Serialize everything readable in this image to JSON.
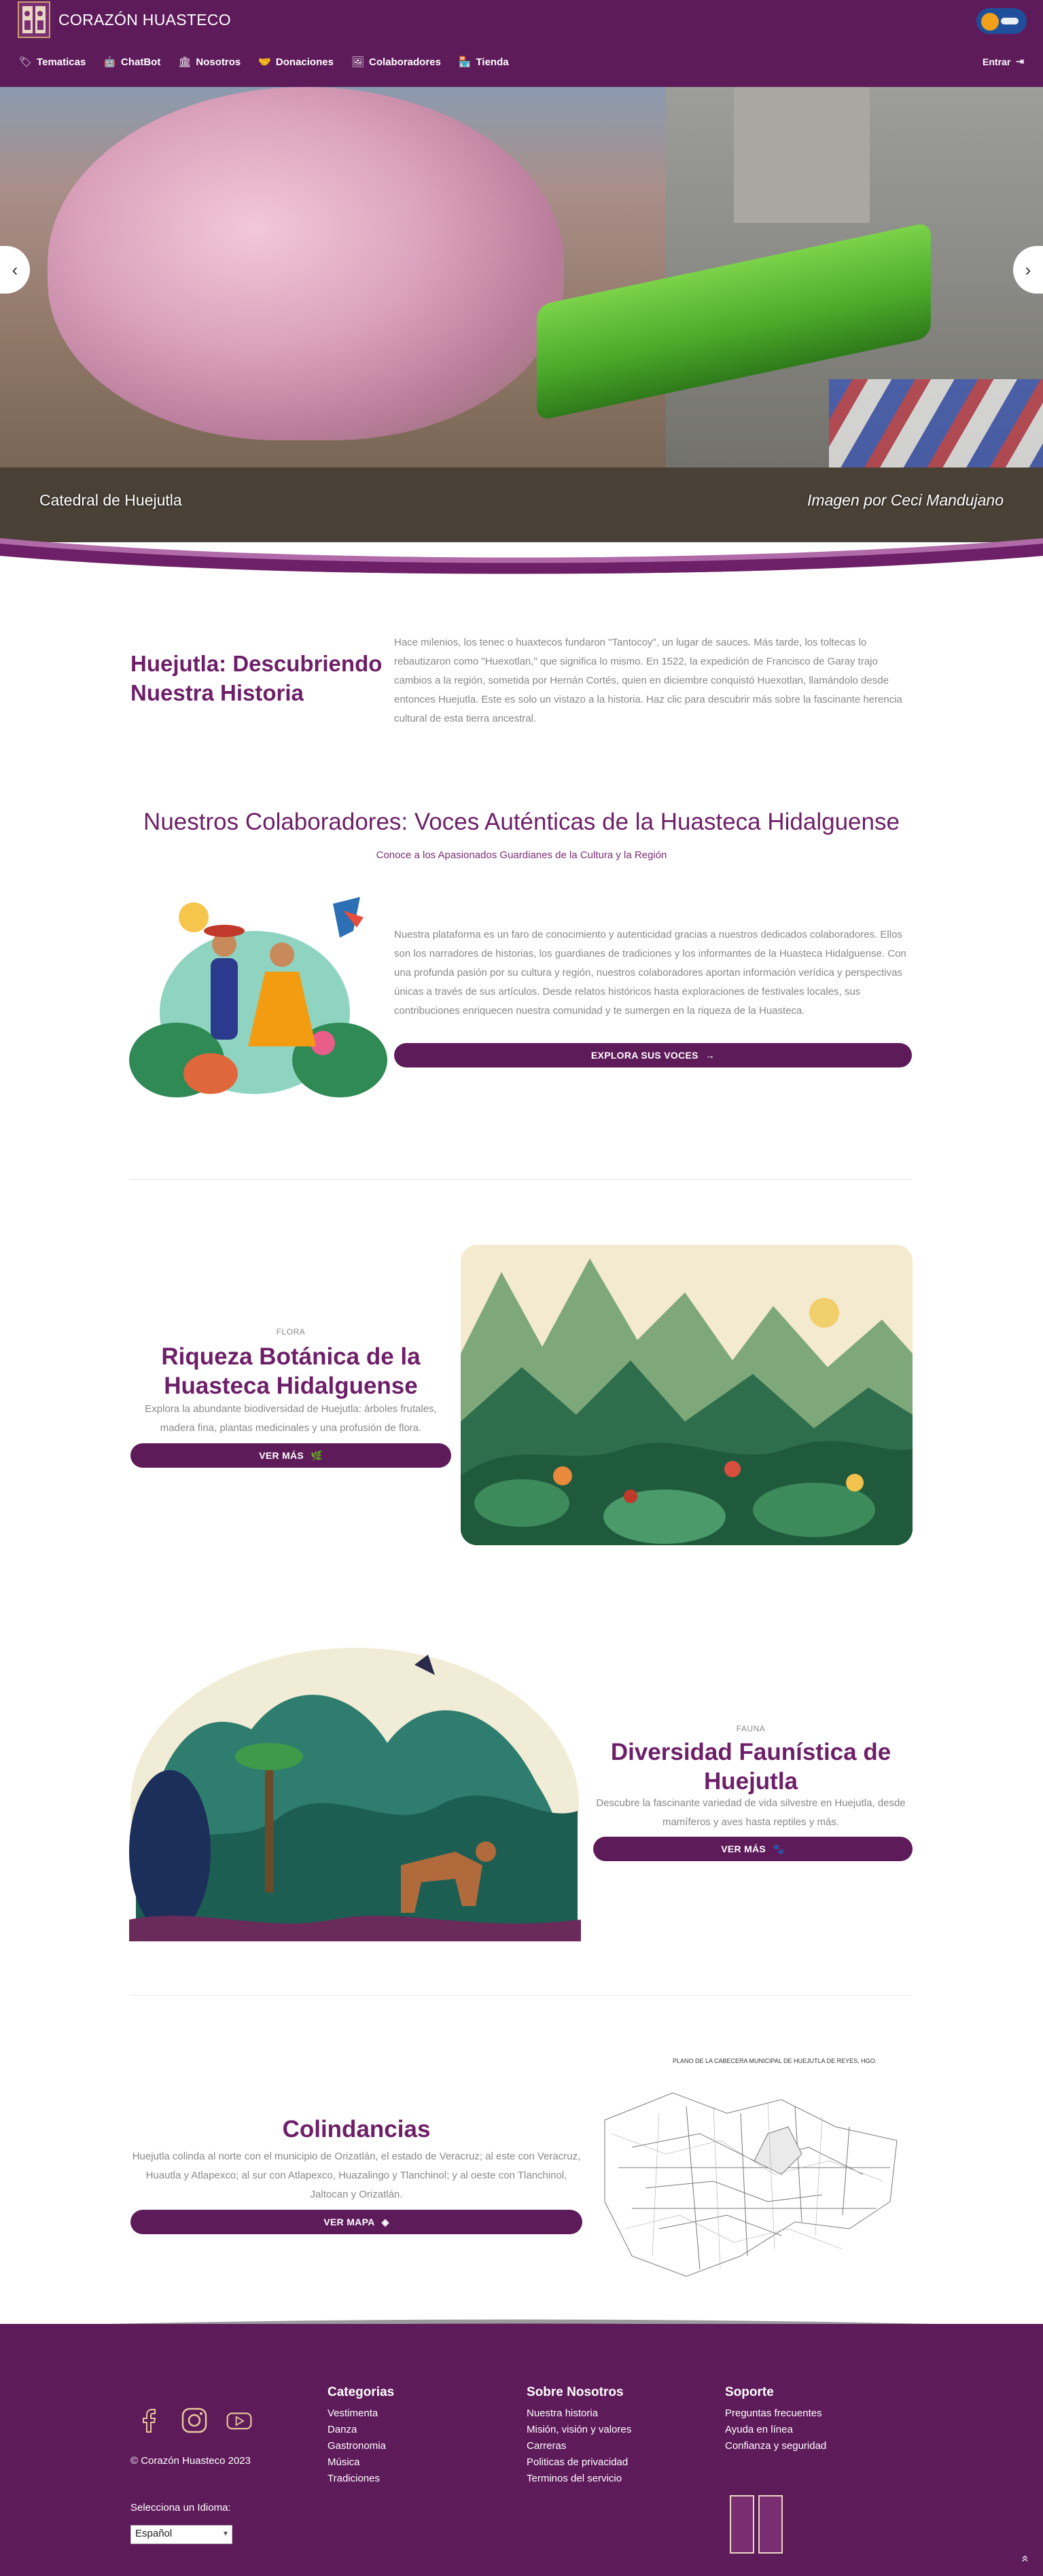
{
  "brand": {
    "name": "CORAZÓN HUASTECO"
  },
  "nav": {
    "items": [
      {
        "label": "Tematicas",
        "icon": "🏷"
      },
      {
        "label": "ChatBot",
        "icon": "🤖"
      },
      {
        "label": "Nosotros",
        "icon": "🏛"
      },
      {
        "label": "Donaciones",
        "icon": "🤝"
      },
      {
        "label": "Colaboradores",
        "icon": "🖼"
      },
      {
        "label": "Tienda",
        "icon": "🏪"
      }
    ],
    "login_label": "Entrar",
    "login_icon": "⇥"
  },
  "hero": {
    "caption": "Catedral de Huejutla",
    "credit": "Imagen por Ceci Mandujano"
  },
  "history": {
    "title": "Huejutla: Descubriendo Nuestra Historia",
    "text": "Hace milenios, los tenec o huaxtecos fundaron \"Tantocoy\", un lugar de sauces. Más tarde, los toltecas lo rebautizaron como \"Huexotlan,\" que significa lo mismo. En 1522, la expedición de Francisco de Garay trajo cambios a la región, sometida por Hernán Cortés, quien en diciembre conquistó Huexotlan, llamándolo desde entonces Huejutla. Este es solo un vistazo a la historia. Haz clic para descubrir más sobre la fascinante herencia cultural de esta tierra ancestral."
  },
  "collaborators": {
    "title": "Nuestros Colaboradores: Voces Auténticas de la Huasteca Hidalguense",
    "subtitle": "Conoce a los Apasionados Guardianes de la Cultura y la Región",
    "text": "Nuestra plataforma es un faro de conocimiento y autenticidad gracias a nuestros dedicados colaboradores. Ellos son los narradores de historias, los guardianes de tradiciones y los informantes de la Huasteca Hidalguense. Con una profunda pasión por su cultura y región, nuestros colaboradores aportan información verídica y perspectivas únicas a través de sus artículos. Desde relatos históricos hasta exploraciones de festivales locales, sus contribuciones enriquecen nuestra comunidad y te sumergen en la riqueza de la Huasteca.",
    "button": "EXPLORA SUS VOCES",
    "button_icon": "→"
  },
  "flora": {
    "label": "FLORA",
    "title": "Riqueza Botánica de la Huasteca Hidalguense",
    "text": "Explora la abundante biodiversidad de Huejutla: árboles frutales, madera fina, plantas medicinales y una profusión de flora.",
    "button": "VER MÁS",
    "button_icon": "🌿"
  },
  "fauna": {
    "label": "FAUNA",
    "title": "Diversidad Faunística de Huejutla",
    "text": "Descubre la fascinante variedad de vida silvestre en Huejutla, desde mamíferos y aves hasta reptiles y más.",
    "button": "VER MÁS",
    "button_icon": "🐾"
  },
  "borders": {
    "title": "Colindancias",
    "text": "Huejutla colinda al norte con el municipio de Orizatlán, el estado de Veracruz; al este con Veracruz, Huautla y Atlapexco; al sur con Atlapexco, Huazalingo y Tlanchinol; y al oeste con Tlanchinol, Jaltocan y Orizatlán.",
    "button": "VER MAPA",
    "button_icon": "◈",
    "map_heading": "PLANO DE LA CABECERA MUNICIPAL DE HUEJUTLA DE REYES, HGO."
  },
  "footer": {
    "copyright": "© Corazón Huasteco 2023",
    "columns": [
      {
        "title": "Categorias",
        "items": [
          "Vestimenta",
          "Danza",
          "Gastronomia",
          "Música",
          "Tradiciones"
        ]
      },
      {
        "title": "Sobre Nosotros",
        "items": [
          "Nuestra historia",
          "Misión, visión y valores",
          "Carreras",
          "Politicas de privacidad",
          "Terminos del servicio"
        ]
      },
      {
        "title": "Soporte",
        "items": [
          "Preguntas frecuentes",
          "Ayuda en línea",
          "Confianza y seguridad"
        ]
      }
    ],
    "language_label": "Selecciona un Idioma:",
    "language_value": "Español",
    "scroll_icon": "»"
  },
  "colors": {
    "primary": "#5e1b5a",
    "accent": "#6d1f68",
    "toggle_bg": "#1f4f9a",
    "toggle_knob": "#f2a01c"
  }
}
